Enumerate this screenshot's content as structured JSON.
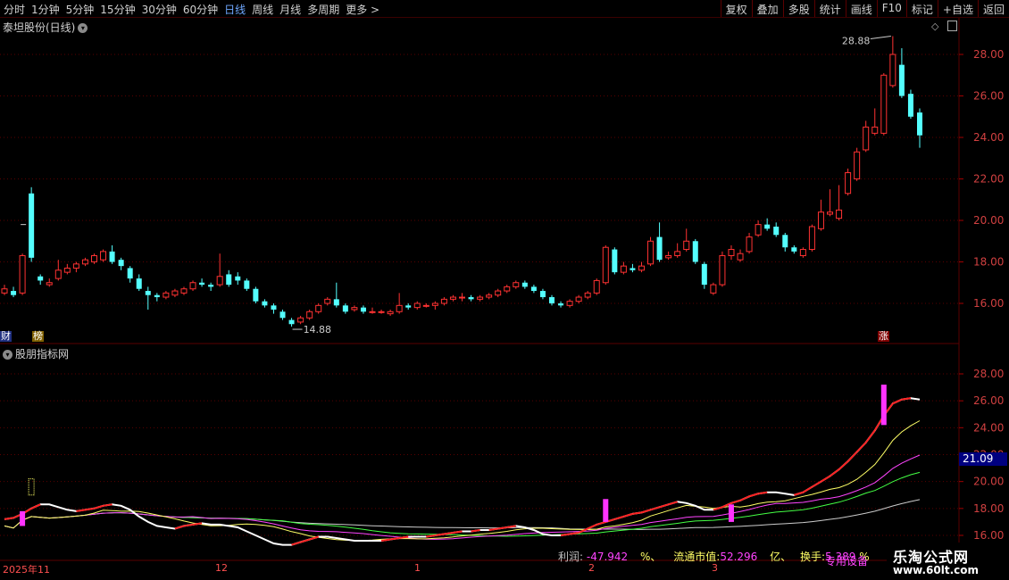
{
  "toolbar": {
    "periods": [
      "分时",
      "1分钟",
      "5分钟",
      "15分钟",
      "30分钟",
      "60分钟",
      "日线",
      "周线",
      "月线",
      "多周期",
      "更多 >"
    ],
    "active_period": "日线",
    "actions": [
      "复权",
      "叠加",
      "多股",
      "统计",
      "画线",
      "F10",
      "标记",
      "+自选",
      "返回"
    ]
  },
  "main_panel": {
    "title": "泰坦股份(日线)",
    "y_axis_labels": [
      "28.00",
      "26.00",
      "24.00",
      "22.00",
      "20.00",
      "18.00",
      "16.00"
    ],
    "high_marker": "28.88",
    "low_marker": "14.88",
    "badges": {
      "left_1": "财",
      "left_2": "榜",
      "right": "涨"
    }
  },
  "sub_panel": {
    "title": "股朋指标网",
    "y_axis_labels": [
      "28.00",
      "26.00",
      "24.00",
      "22.00",
      "20.00",
      "18.00",
      "16.00"
    ],
    "price_tag": "21.09",
    "info": {
      "profit_label": "利润:",
      "profit_value": "-47.942",
      "profit_unit": "%、",
      "mcap_label": "流通市值:",
      "mcap_value": "52.296",
      "mcap_unit": "亿、",
      "turnover_label": "换手:",
      "turnover_value": "5.389",
      "turnover_unit": "%",
      "overlay_text": "专用设备"
    }
  },
  "time_axis": {
    "labels": [
      "2025年11",
      "12",
      "1",
      "2",
      "3"
    ]
  },
  "watermark": {
    "line1": "乐淘公式网",
    "line2": "www.60lt.com"
  },
  "colors": {
    "up": "#ff3232",
    "down": "#54ffff",
    "grid": "#5a0000",
    "ma_white": "#ffffff",
    "ma_yellow": "#ffff66",
    "ma_magenta": "#ff44ff",
    "ma_green": "#44ff44",
    "ma_gray": "#cccccc",
    "signal": "#ff33ff"
  },
  "chart_data": {
    "type": "candlestick",
    "y_range": [
      14.5,
      29.2
    ],
    "candles": [
      [
        16.5,
        16.7,
        16.9,
        16.4
      ],
      [
        16.6,
        16.4,
        16.8,
        16.3
      ],
      [
        16.5,
        18.3,
        18.4,
        16.4
      ],
      [
        21.3,
        18.2,
        21.6,
        18.0
      ],
      [
        17.3,
        17.1,
        17.4,
        16.9
      ],
      [
        16.9,
        17.0,
        17.2,
        16.8
      ],
      [
        17.2,
        17.6,
        18.1,
        17.1
      ],
      [
        17.5,
        17.7,
        17.9,
        17.4
      ],
      [
        17.7,
        17.9,
        18.0,
        17.5
      ],
      [
        17.9,
        18.1,
        18.2,
        17.8
      ],
      [
        18.0,
        18.3,
        18.4,
        17.9
      ],
      [
        18.1,
        18.5,
        18.6,
        18.0
      ],
      [
        18.5,
        18.0,
        18.8,
        17.9
      ],
      [
        18.1,
        17.8,
        18.2,
        17.6
      ],
      [
        17.7,
        17.2,
        17.8,
        17.0
      ],
      [
        17.2,
        16.7,
        17.4,
        16.6
      ],
      [
        16.6,
        16.4,
        16.8,
        15.7
      ],
      [
        16.4,
        16.3,
        16.5,
        16.1
      ],
      [
        16.3,
        16.5,
        16.6,
        16.2
      ],
      [
        16.4,
        16.6,
        16.7,
        16.3
      ],
      [
        16.5,
        16.7,
        16.8,
        16.4
      ],
      [
        16.7,
        17.0,
        17.1,
        16.6
      ],
      [
        17.0,
        16.9,
        17.2,
        16.8
      ],
      [
        16.9,
        16.8,
        17.0,
        16.6
      ],
      [
        16.9,
        17.3,
        18.4,
        16.8
      ],
      [
        17.4,
        16.9,
        17.6,
        16.8
      ],
      [
        17.3,
        17.1,
        17.5,
        16.9
      ],
      [
        17.1,
        16.7,
        17.2,
        16.6
      ],
      [
        16.7,
        16.1,
        16.8,
        16.0
      ],
      [
        16.1,
        15.9,
        16.2,
        15.8
      ],
      [
        15.9,
        15.7,
        16.0,
        15.5
      ],
      [
        15.6,
        15.3,
        15.7,
        15.2
      ],
      [
        15.2,
        15.0,
        15.3,
        14.88
      ],
      [
        15.1,
        15.3,
        15.4,
        15.0
      ],
      [
        15.3,
        15.6,
        15.7,
        15.2
      ],
      [
        15.6,
        15.9,
        16.0,
        15.5
      ],
      [
        16.0,
        16.2,
        16.3,
        15.9
      ],
      [
        16.2,
        15.9,
        17.0,
        15.8
      ],
      [
        15.9,
        15.6,
        16.0,
        15.5
      ],
      [
        15.7,
        15.8,
        15.9,
        15.6
      ],
      [
        15.8,
        15.6,
        15.9,
        15.5
      ],
      [
        15.6,
        15.6,
        15.8,
        15.5
      ],
      [
        15.6,
        15.6,
        15.7,
        15.5
      ],
      [
        15.5,
        15.6,
        15.7,
        15.4
      ],
      [
        15.6,
        15.9,
        16.5,
        15.5
      ],
      [
        15.9,
        15.8,
        16.0,
        15.7
      ],
      [
        15.8,
        16.0,
        16.1,
        15.7
      ],
      [
        15.9,
        15.9,
        16.0,
        15.8
      ],
      [
        15.9,
        16.0,
        16.1,
        15.7
      ],
      [
        16.0,
        16.2,
        16.3,
        15.9
      ],
      [
        16.2,
        16.3,
        16.4,
        16.1
      ],
      [
        16.3,
        16.3,
        16.5,
        16.1
      ],
      [
        16.3,
        16.2,
        16.4,
        16.1
      ],
      [
        16.2,
        16.3,
        16.4,
        16.1
      ],
      [
        16.3,
        16.4,
        16.5,
        16.2
      ],
      [
        16.4,
        16.6,
        16.7,
        16.3
      ],
      [
        16.6,
        16.8,
        16.9,
        16.5
      ],
      [
        16.8,
        17.0,
        17.1,
        16.7
      ],
      [
        17.0,
        16.8,
        17.1,
        16.7
      ],
      [
        16.8,
        16.6,
        16.9,
        16.5
      ],
      [
        16.6,
        16.3,
        16.7,
        16.2
      ],
      [
        16.3,
        16.0,
        16.4,
        15.9
      ],
      [
        16.0,
        15.9,
        16.1,
        15.8
      ],
      [
        15.9,
        16.1,
        16.2,
        15.8
      ],
      [
        16.1,
        16.3,
        16.4,
        16.0
      ],
      [
        16.3,
        16.5,
        16.6,
        16.2
      ],
      [
        16.5,
        17.1,
        17.2,
        16.4
      ],
      [
        17.0,
        18.7,
        18.8,
        16.9
      ],
      [
        18.6,
        17.5,
        18.7,
        17.4
      ],
      [
        17.5,
        17.8,
        18.0,
        17.4
      ],
      [
        17.7,
        17.6,
        17.9,
        17.5
      ],
      [
        17.6,
        17.8,
        18.0,
        17.5
      ],
      [
        17.9,
        19.0,
        19.2,
        17.8
      ],
      [
        19.2,
        18.1,
        19.9,
        18.0
      ],
      [
        18.2,
        18.3,
        18.5,
        18.1
      ],
      [
        18.3,
        18.5,
        18.9,
        18.2
      ],
      [
        18.6,
        19.0,
        19.6,
        18.5
      ],
      [
        19.0,
        18.0,
        19.1,
        17.9
      ],
      [
        17.9,
        16.9,
        18.0,
        16.7
      ],
      [
        16.5,
        16.9,
        17.0,
        16.4
      ],
      [
        16.9,
        18.3,
        18.5,
        16.8
      ],
      [
        18.3,
        18.6,
        18.8,
        18.1
      ],
      [
        18.1,
        18.4,
        18.6,
        18.0
      ],
      [
        18.5,
        19.2,
        19.4,
        18.4
      ],
      [
        19.3,
        19.8,
        20.0,
        19.2
      ],
      [
        19.8,
        19.6,
        20.1,
        19.5
      ],
      [
        19.7,
        19.3,
        19.9,
        19.2
      ],
      [
        19.3,
        18.7,
        19.4,
        18.5
      ],
      [
        18.7,
        18.5,
        18.8,
        18.4
      ],
      [
        18.3,
        18.6,
        18.7,
        18.2
      ],
      [
        18.6,
        19.7,
        19.8,
        18.5
      ],
      [
        19.6,
        20.4,
        21.0,
        19.5
      ],
      [
        20.3,
        20.4,
        21.5,
        20.2
      ],
      [
        20.1,
        20.5,
        21.7,
        20.0
      ],
      [
        21.3,
        22.3,
        22.5,
        21.2
      ],
      [
        22.0,
        23.3,
        23.5,
        21.9
      ],
      [
        23.4,
        24.5,
        24.8,
        23.3
      ],
      [
        24.2,
        24.5,
        25.4,
        24.1
      ],
      [
        24.2,
        27.0,
        27.1,
        24.1
      ],
      [
        26.5,
        28.0,
        28.88,
        26.4
      ],
      [
        27.5,
        26.0,
        28.3,
        25.9
      ],
      [
        26.1,
        25.0,
        26.3,
        24.9
      ],
      [
        25.2,
        24.1,
        25.4,
        23.5
      ]
    ],
    "ma_lines": [
      {
        "name": "white",
        "values": [
          17.2,
          17.3,
          17.6,
          18.0,
          18.3,
          18.3,
          18.1,
          17.9,
          17.8,
          17.9,
          18.0,
          18.2,
          18.3,
          18.2,
          17.9,
          17.4,
          17.0,
          16.7,
          16.6,
          16.5,
          16.7,
          16.8,
          16.9,
          16.8,
          16.8,
          16.7,
          16.6,
          16.3,
          16.0,
          15.7,
          15.4,
          15.3,
          15.3,
          15.5,
          15.7,
          15.9,
          15.9,
          15.8,
          15.7,
          15.6,
          15.6,
          15.6,
          15.6,
          15.7,
          15.8,
          15.9,
          15.9,
          15.9,
          16.0,
          16.1,
          16.2,
          16.3,
          16.3,
          16.4,
          16.4,
          16.5,
          16.6,
          16.7,
          16.6,
          16.4,
          16.1,
          16.0,
          16.0,
          16.1,
          16.2,
          16.5,
          16.8,
          17.0,
          17.2,
          17.4,
          17.6,
          17.7,
          17.9,
          18.1,
          18.3,
          18.5,
          18.4,
          18.2,
          17.9,
          17.9,
          18.1,
          18.4,
          18.6,
          18.9,
          19.1,
          19.2,
          19.2,
          19.1,
          19.0,
          19.2,
          19.6,
          20.0,
          20.4,
          20.9,
          21.5,
          22.2,
          22.9,
          23.8,
          24.9,
          25.8,
          26.1,
          26.2,
          26.1
        ]
      }
    ],
    "price_tag_value": 21.09
  }
}
